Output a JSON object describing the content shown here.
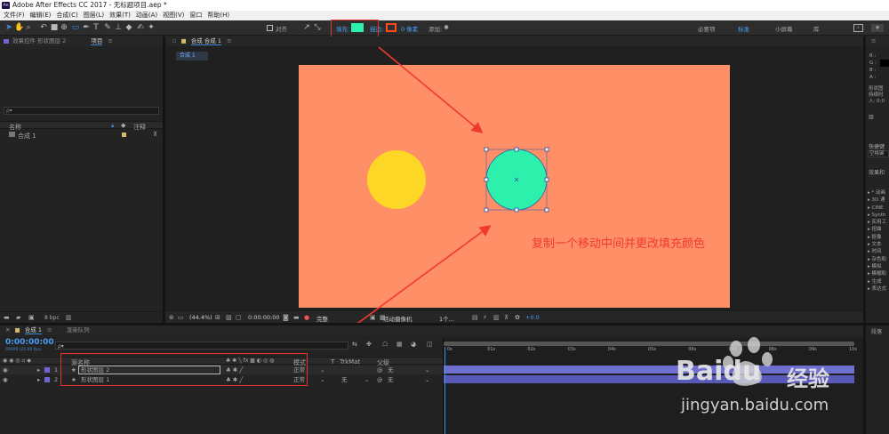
{
  "app": {
    "title": "Adobe After Effects CC 2017 - 无标题项目.aep *",
    "logo": "Ae"
  },
  "menu": [
    "文件(F)",
    "编辑(E)",
    "合成(C)",
    "图层(L)",
    "效果(T)",
    "动画(A)",
    "视图(V)",
    "窗口",
    "帮助(H)"
  ],
  "toolbar": {
    "align_label": "对齐",
    "fill_label": "填充:",
    "stroke_label": "描边:",
    "stroke_width": "0 像素",
    "add_label": "添加:",
    "fill_color": "#2ef0ad",
    "stroke_color": "#ff4a1c",
    "workspaces": [
      "必要项",
      "标准",
      "小屏幕",
      "库"
    ],
    "active_workspace": "标准"
  },
  "left_panel": {
    "tabs": [
      "效果控件 形状图层 2",
      "项目"
    ],
    "search_placeholder": "ρ▾",
    "col_name": "名称",
    "col_comment": "注释",
    "item": "合成 1",
    "bpc": "8 bpc"
  },
  "comp_panel": {
    "tab": "合成 合成 1",
    "breadcrumb": "合成 1",
    "bg_color": "#ff8f66",
    "zoom": "(44.4%)",
    "timecode": "0:00:00:00",
    "resolution": "完整",
    "camera": "活动摄像机",
    "views": "1个...",
    "exposure": "+0.0"
  },
  "annotation": {
    "text": "复制一个移动中间并更改填充颜色",
    "color": "#f03a2e"
  },
  "right_panel": {
    "info_lines": [
      "R :",
      "G :",
      "B :",
      "A :"
    ],
    "shape_text": "形状图",
    "duration_text": "持续时",
    "in_text": "入: 0:0",
    "sections": [
      "快捷键",
      "效果和"
    ],
    "shortcut": "空格键",
    "effects": [
      "* 动画",
      "3D 通",
      "CINE",
      "Synth",
      "实用工",
      "扭曲",
      "抠像",
      "文本",
      "时间",
      "杂色和",
      "模拟",
      "模糊和",
      "生成",
      "表达式"
    ],
    "bottom_tab": "段落"
  },
  "timeline": {
    "tabs": [
      "合成 1",
      "渲染队列"
    ],
    "timecode": "0:00:00:00",
    "fps": "00000 (25.00 fps)",
    "columns": {
      "source": "源名称",
      "mode": "模式",
      "trkmat": "TrkMat",
      "parent": "父级"
    },
    "ruler": [
      "0s",
      "01s",
      "02s",
      "03s",
      "04s",
      "05s",
      "06s",
      "07s",
      "08s",
      "09s",
      "10s"
    ],
    "layers": [
      {
        "num": "1",
        "name": "形状图层 2",
        "mode": "正常",
        "trk": "",
        "parent": "无"
      },
      {
        "num": "2",
        "name": "形状图层 1",
        "mode": "正常",
        "trk": "无",
        "parent": "无"
      }
    ]
  },
  "watermark": {
    "brand": "Baidu",
    "brand_cn": "经验",
    "url": "jingyan.baidu.com"
  }
}
